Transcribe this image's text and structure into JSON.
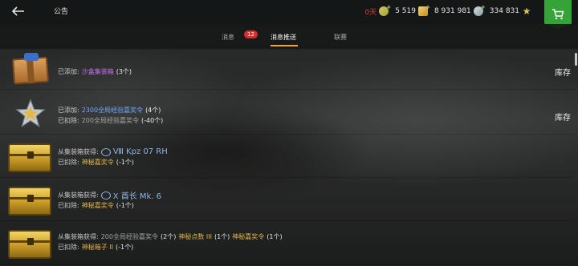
{
  "header": {
    "title": "公告",
    "currencies": {
      "premium": "0天",
      "gold": "5 519",
      "credits": "8 931 981",
      "free_xp": "334 831"
    }
  },
  "tabs": [
    {
      "label": "消息",
      "badge": "12"
    },
    {
      "label": "消息推送"
    },
    {
      "label": "联赛"
    }
  ],
  "messages": [
    {
      "icon": "wooden-crate-icon",
      "lines": [
        {
          "label": "已添加:",
          "item": "沙盒集装箱",
          "count": "(3个)"
        }
      ],
      "action": "库存"
    },
    {
      "icon": "star-badge-icon",
      "lines": [
        {
          "label": "已添加:",
          "item": "2300全局经验嘉奖令",
          "count": "(4个)"
        },
        {
          "label": "已扣除:",
          "item": "200全局经验嘉奖令",
          "count": "(-40个)"
        }
      ],
      "action": "库存"
    },
    {
      "icon": "gold-crate-icon",
      "source": "从集装箱获得:",
      "tank": "Ⅷ Kpz 07 RH",
      "lines": [
        {
          "label": "已扣除:",
          "item": "神秘嘉奖令",
          "count": "(-1个)"
        }
      ]
    },
    {
      "icon": "gold-crate-icon",
      "source": "从集装箱获得:",
      "tank": "Ⅹ 酋长 Mk. 6",
      "lines": [
        {
          "label": "已扣除:",
          "item": "神秘嘉奖令",
          "count": "(-1个)"
        }
      ]
    },
    {
      "icon": "gold-crate-icon",
      "source": "从集装箱获得:",
      "rewards": [
        {
          "item": "200全局经验嘉奖令",
          "count": "(2个)"
        },
        {
          "item": "神秘点数 III",
          "count": "(1个)"
        },
        {
          "item": "神秘嘉奖令",
          "count": "(1个)"
        }
      ],
      "lines": [
        {
          "label": "已扣除:",
          "item": "神秘箱子 II",
          "count": "(-1个)"
        }
      ]
    }
  ],
  "colors": {
    "accent_tab": "#f2a534",
    "shop": "#35a338",
    "badge": "#d62d2d",
    "purple_item": "#c96ef0",
    "blue_item": "#6fa8ff",
    "gold_item": "#e3b54a"
  }
}
